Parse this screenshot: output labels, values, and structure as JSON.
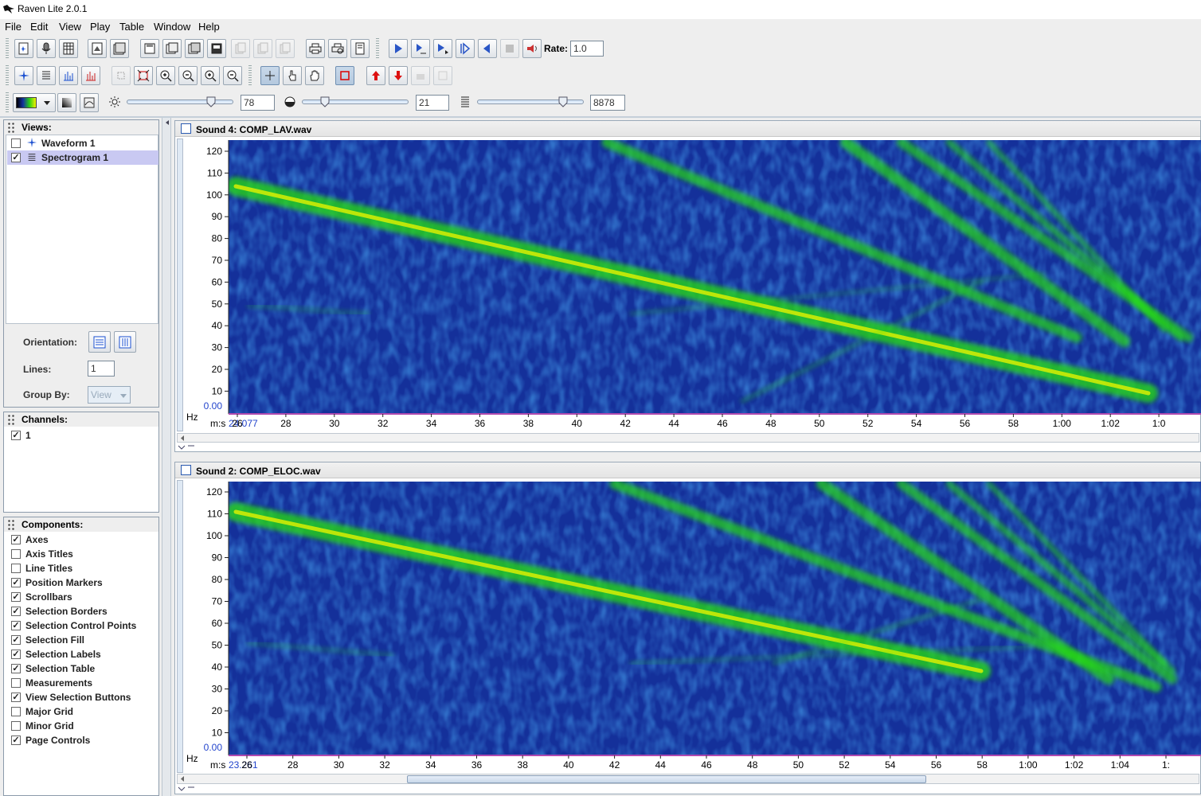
{
  "window": {
    "title": "Raven Lite 2.0.1"
  },
  "menu": [
    "File",
    "Edit",
    "View",
    "Play",
    "Table",
    "Window",
    "Help"
  ],
  "toolbar": {
    "rate_label": "Rate:",
    "rate_value": "1.0",
    "brightness_value": "78",
    "contrast_value": "21",
    "size_value": "8878"
  },
  "sidebar": {
    "views_title": "Views:",
    "views": [
      {
        "label": "Waveform 1",
        "checked": false,
        "selected": false
      },
      {
        "label": "Spectrogram 1",
        "checked": true,
        "selected": true
      }
    ],
    "orientation_label": "Orientation:",
    "lines_label": "Lines:",
    "lines_value": "1",
    "groupby_label": "Group By:",
    "groupby_value": "View",
    "channels_title": "Channels:",
    "channels": [
      {
        "label": "1",
        "checked": true
      }
    ],
    "components_title": "Components:",
    "components": [
      {
        "label": "Axes",
        "checked": true
      },
      {
        "label": "Axis Titles",
        "checked": false
      },
      {
        "label": "Line Titles",
        "checked": false
      },
      {
        "label": "Position Markers",
        "checked": true
      },
      {
        "label": "Scrollbars",
        "checked": true
      },
      {
        "label": "Selection Borders",
        "checked": true
      },
      {
        "label": "Selection Control Points",
        "checked": true
      },
      {
        "label": "Selection Fill",
        "checked": true
      },
      {
        "label": "Selection Labels",
        "checked": true
      },
      {
        "label": "Selection Table",
        "checked": true
      },
      {
        "label": "Measurements",
        "checked": false
      },
      {
        "label": "View Selection Buttons",
        "checked": true
      },
      {
        "label": "Major Grid",
        "checked": false
      },
      {
        "label": "Minor Grid",
        "checked": false
      },
      {
        "label": "Page Controls",
        "checked": true
      }
    ]
  },
  "sounds": [
    {
      "title": "Sound 4: COMP_LAV.wav",
      "y_unit": "Hz",
      "y_ticks": [
        "120",
        "110",
        "100",
        "90",
        "80",
        "70",
        "60",
        "50",
        "40",
        "30",
        "20",
        "10"
      ],
      "y_zero": "0.00",
      "x_unit": "m:s",
      "x_start": "24.077",
      "x_ticks": [
        "26",
        "28",
        "30",
        "32",
        "34",
        "36",
        "38",
        "40",
        "42",
        "44",
        "46",
        "48",
        "50",
        "52",
        "54",
        "56",
        "58",
        "1:00",
        "1:02",
        "1:0"
      ]
    },
    {
      "title": "Sound 2: COMP_ELOC.wav",
      "y_unit": "Hz",
      "y_ticks": [
        "120",
        "110",
        "100",
        "90",
        "80",
        "70",
        "60",
        "50",
        "40",
        "30",
        "20",
        "10"
      ],
      "y_zero": "0.00",
      "x_unit": "m:s",
      "x_start": "23.261",
      "x_ticks": [
        "26",
        "28",
        "30",
        "32",
        "34",
        "36",
        "38",
        "40",
        "42",
        "44",
        "46",
        "48",
        "50",
        "52",
        "54",
        "56",
        "58",
        "1:00",
        "1:02",
        "1:04",
        "1:"
      ]
    }
  ],
  "colors": {
    "spectrogram_bg": "#14309a",
    "signal": "#27e00f",
    "signal_peak": "#e4f300"
  }
}
